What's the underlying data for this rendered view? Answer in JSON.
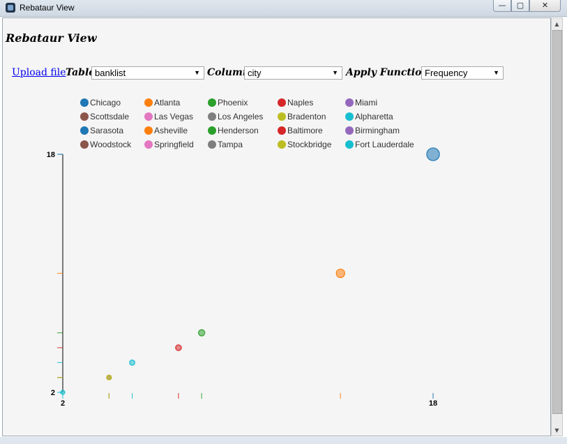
{
  "window": {
    "title": "Rebataur View",
    "minimize": "—",
    "maximize": "▢",
    "close": "✕"
  },
  "page": {
    "title": "Rebataur View"
  },
  "controls": {
    "upload_label": "Upload file",
    "table_label": "Table",
    "table_value": "banklist",
    "column_label": "Column",
    "column_value": "city",
    "function_label": "Apply Function",
    "function_value": "Frequency"
  },
  "legend": [
    {
      "label": "Chicago",
      "color": "#1f77b4"
    },
    {
      "label": "Atlanta",
      "color": "#ff7f0e"
    },
    {
      "label": "Phoenix",
      "color": "#2ca02c"
    },
    {
      "label": "Naples",
      "color": "#d62728"
    },
    {
      "label": "Miami",
      "color": "#9467bd"
    },
    {
      "label": "Scottsdale",
      "color": "#8c564b"
    },
    {
      "label": "Las Vegas",
      "color": "#e377c2"
    },
    {
      "label": "Los Angeles",
      "color": "#7f7f7f"
    },
    {
      "label": "Bradenton",
      "color": "#bcbd22"
    },
    {
      "label": "Alpharetta",
      "color": "#17becf"
    },
    {
      "label": "Sarasota",
      "color": "#1f77b4"
    },
    {
      "label": "Asheville",
      "color": "#ff7f0e"
    },
    {
      "label": "Henderson",
      "color": "#2ca02c"
    },
    {
      "label": "Baltimore",
      "color": "#d62728"
    },
    {
      "label": "Birmingham",
      "color": "#9467bd"
    },
    {
      "label": "Woodstock",
      "color": "#8c564b"
    },
    {
      "label": "Springfield",
      "color": "#e377c2"
    },
    {
      "label": "Tampa",
      "color": "#7f7f7f"
    },
    {
      "label": "Stockbridge",
      "color": "#bcbd22"
    },
    {
      "label": "Fort Lauderdale",
      "color": "#17becf"
    }
  ],
  "chart_data": {
    "type": "scatter",
    "x_ticks": [
      "2",
      "18"
    ],
    "y_ticks": [
      "2",
      "18"
    ],
    "xlim": [
      2,
      18
    ],
    "ylim": [
      2,
      18
    ],
    "points": [
      {
        "x": 18,
        "y": 18,
        "color": "#1f77b4"
      },
      {
        "x": 14,
        "y": 10,
        "color": "#ff7f0e"
      },
      {
        "x": 8,
        "y": 6,
        "color": "#2ca02c"
      },
      {
        "x": 7,
        "y": 5,
        "color": "#d62728"
      },
      {
        "x": 5,
        "y": 4,
        "color": "#17becf"
      },
      {
        "x": 4,
        "y": 3,
        "color": "#8c564b"
      },
      {
        "x": 4,
        "y": 3,
        "color": "#bcbd22"
      },
      {
        "x": 2,
        "y": 2,
        "color": "#17becf"
      }
    ]
  }
}
